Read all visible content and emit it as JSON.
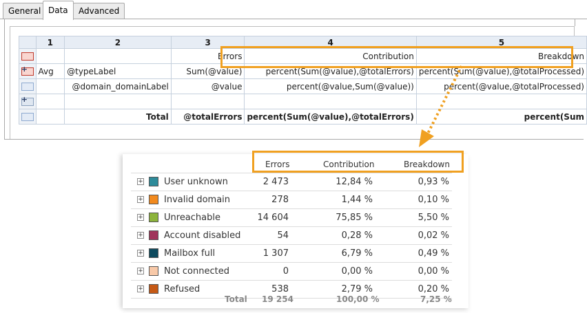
{
  "tabs": [
    {
      "label": "General"
    },
    {
      "label": "Data"
    },
    {
      "label": "Advanced"
    }
  ],
  "designer": {
    "columns": [
      "1",
      "2",
      "3",
      "4",
      "5"
    ],
    "rows": [
      {
        "c1": "",
        "c2": "",
        "c3": "Errors",
        "c4": "Contribution",
        "c5": "Breakdown"
      },
      {
        "c1": "Avg",
        "c2": "@typeLabel",
        "c3": "Sum(@value)",
        "c4": "percent(Sum(@value),@totalErrors)",
        "c5": "percent(Sum(@value),@totalProcessed)"
      },
      {
        "c1": "",
        "c2": "@domain_domainLabel",
        "c3": "@value",
        "c4": "percent(@value,Sum(@value))",
        "c5": "percent(@value,@totalProcessed)"
      },
      {
        "c1": "",
        "c2": "",
        "c3": "",
        "c4": "",
        "c5": ""
      },
      {
        "c1": "",
        "c2": "Total",
        "c3": "@totalErrors",
        "c4": "percent(Sum(@value),@totalErrors)",
        "c5": "percent(Sum"
      }
    ]
  },
  "report": {
    "headers": {
      "errors": "Errors",
      "contribution": "Contribution",
      "breakdown": "Breakdown"
    },
    "rows": [
      {
        "label": "User unknown",
        "color": "#2e8b9a",
        "errors": "2 473",
        "contribution": "12,84 %",
        "breakdown": "0,93 %"
      },
      {
        "label": "Invalid domain",
        "color": "#f28a1e",
        "errors": "278",
        "contribution": "1,44 %",
        "breakdown": "0,10 %"
      },
      {
        "label": "Unreachable",
        "color": "#8db43c",
        "errors": "14 604",
        "contribution": "75,85 %",
        "breakdown": "5,50 %"
      },
      {
        "label": "Account disabled",
        "color": "#a0345a",
        "errors": "54",
        "contribution": "0,28 %",
        "breakdown": "0,02 %"
      },
      {
        "label": "Mailbox full",
        "color": "#0d4a5e",
        "errors": "1 307",
        "contribution": "6,79 %",
        "breakdown": "0,49 %"
      },
      {
        "label": "Not connected",
        "color": "#f8c9a8",
        "errors": "0",
        "contribution": "0,00 %",
        "breakdown": "0,00 %"
      },
      {
        "label": "Refused",
        "color": "#c65a16",
        "errors": "538",
        "contribution": "2,79 %",
        "breakdown": "0,20 %"
      }
    ],
    "total": {
      "label": "Total",
      "errors": "19 254",
      "contribution": "100,00 %",
      "breakdown": "7,25 %"
    }
  }
}
